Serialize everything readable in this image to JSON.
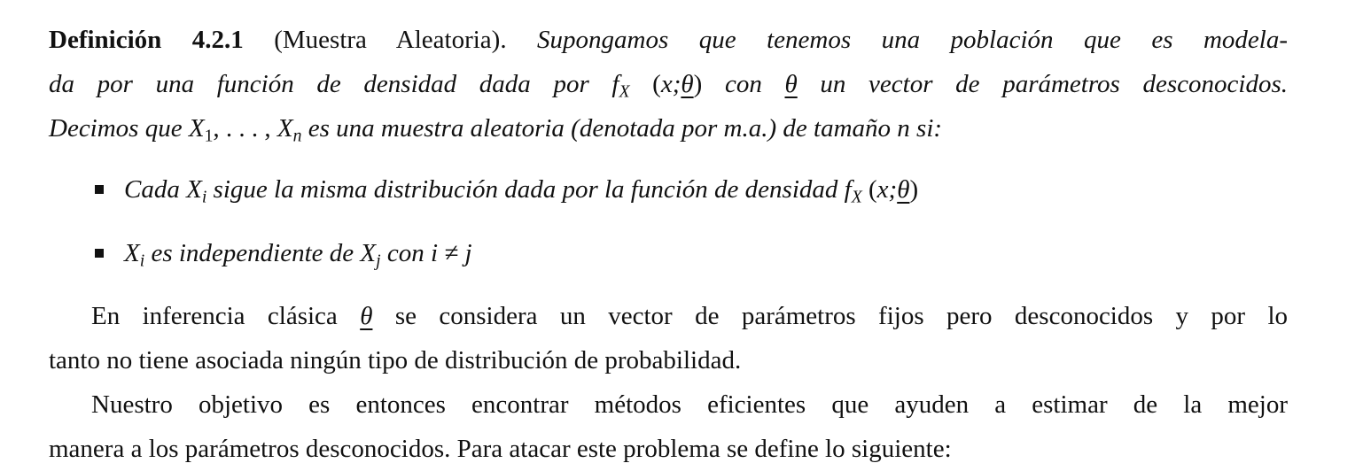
{
  "definition": {
    "label": "Definición 4.2.1",
    "name": "(Muestra Aleatoria).",
    "line1": "Supongamos que tenemos una población que es modela-",
    "line2_a": "da por una función de densidad dada por",
    "line2_b": "con",
    "line2_c": "un vector de parámetros desconocidos.",
    "line3_a": "Decimos que",
    "line3_b": "es una muestra aleatoria (denotada por m.a.) de tamaño",
    "line3_c": "si:"
  },
  "math": {
    "f": "f",
    "X": "X",
    "x_semicolon": "x;",
    "theta": "θ",
    "open_paren": "(",
    "close_paren": ")",
    "sample": "X",
    "sub1": "1",
    "subn": "n",
    "ellipsis": ", . . . , ",
    "n": "n",
    "sub_i": "i",
    "sub_j": "j",
    "neq": "i ≠ j"
  },
  "bullets": [
    {
      "a": "Cada",
      "b": "sigue la misma distribución dada por la función de densidad"
    },
    {
      "a": "es independiente de",
      "b": "con"
    }
  ],
  "paragraph1": {
    "line1_a": "En inferencia clásica",
    "line1_b": "se considera un vector de parámetros fijos pero desconocidos y por lo",
    "line2": "tanto no tiene asociada ningún tipo de distribución de probabilidad."
  },
  "paragraph2": {
    "line1": "Nuestro objetivo es entonces encontrar métodos eficientes que ayuden a estimar de la mejor",
    "line2": "manera a los parámetros desconocidos. Para atacar este problema se define lo siguiente:"
  }
}
